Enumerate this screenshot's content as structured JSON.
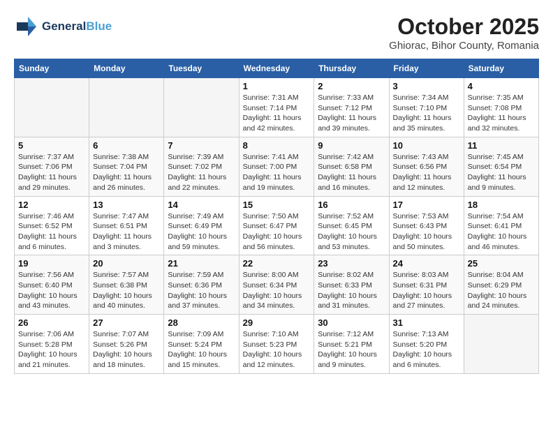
{
  "header": {
    "logo_line1": "General",
    "logo_line2": "Blue",
    "month": "October 2025",
    "location": "Ghiorac, Bihor County, Romania"
  },
  "weekdays": [
    "Sunday",
    "Monday",
    "Tuesday",
    "Wednesday",
    "Thursday",
    "Friday",
    "Saturday"
  ],
  "weeks": [
    [
      {
        "day": "",
        "info": ""
      },
      {
        "day": "",
        "info": ""
      },
      {
        "day": "",
        "info": ""
      },
      {
        "day": "1",
        "info": "Sunrise: 7:31 AM\nSunset: 7:14 PM\nDaylight: 11 hours\nand 42 minutes."
      },
      {
        "day": "2",
        "info": "Sunrise: 7:33 AM\nSunset: 7:12 PM\nDaylight: 11 hours\nand 39 minutes."
      },
      {
        "day": "3",
        "info": "Sunrise: 7:34 AM\nSunset: 7:10 PM\nDaylight: 11 hours\nand 35 minutes."
      },
      {
        "day": "4",
        "info": "Sunrise: 7:35 AM\nSunset: 7:08 PM\nDaylight: 11 hours\nand 32 minutes."
      }
    ],
    [
      {
        "day": "5",
        "info": "Sunrise: 7:37 AM\nSunset: 7:06 PM\nDaylight: 11 hours\nand 29 minutes."
      },
      {
        "day": "6",
        "info": "Sunrise: 7:38 AM\nSunset: 7:04 PM\nDaylight: 11 hours\nand 26 minutes."
      },
      {
        "day": "7",
        "info": "Sunrise: 7:39 AM\nSunset: 7:02 PM\nDaylight: 11 hours\nand 22 minutes."
      },
      {
        "day": "8",
        "info": "Sunrise: 7:41 AM\nSunset: 7:00 PM\nDaylight: 11 hours\nand 19 minutes."
      },
      {
        "day": "9",
        "info": "Sunrise: 7:42 AM\nSunset: 6:58 PM\nDaylight: 11 hours\nand 16 minutes."
      },
      {
        "day": "10",
        "info": "Sunrise: 7:43 AM\nSunset: 6:56 PM\nDaylight: 11 hours\nand 12 minutes."
      },
      {
        "day": "11",
        "info": "Sunrise: 7:45 AM\nSunset: 6:54 PM\nDaylight: 11 hours\nand 9 minutes."
      }
    ],
    [
      {
        "day": "12",
        "info": "Sunrise: 7:46 AM\nSunset: 6:52 PM\nDaylight: 11 hours\nand 6 minutes."
      },
      {
        "day": "13",
        "info": "Sunrise: 7:47 AM\nSunset: 6:51 PM\nDaylight: 11 hours\nand 3 minutes."
      },
      {
        "day": "14",
        "info": "Sunrise: 7:49 AM\nSunset: 6:49 PM\nDaylight: 10 hours\nand 59 minutes."
      },
      {
        "day": "15",
        "info": "Sunrise: 7:50 AM\nSunset: 6:47 PM\nDaylight: 10 hours\nand 56 minutes."
      },
      {
        "day": "16",
        "info": "Sunrise: 7:52 AM\nSunset: 6:45 PM\nDaylight: 10 hours\nand 53 minutes."
      },
      {
        "day": "17",
        "info": "Sunrise: 7:53 AM\nSunset: 6:43 PM\nDaylight: 10 hours\nand 50 minutes."
      },
      {
        "day": "18",
        "info": "Sunrise: 7:54 AM\nSunset: 6:41 PM\nDaylight: 10 hours\nand 46 minutes."
      }
    ],
    [
      {
        "day": "19",
        "info": "Sunrise: 7:56 AM\nSunset: 6:40 PM\nDaylight: 10 hours\nand 43 minutes."
      },
      {
        "day": "20",
        "info": "Sunrise: 7:57 AM\nSunset: 6:38 PM\nDaylight: 10 hours\nand 40 minutes."
      },
      {
        "day": "21",
        "info": "Sunrise: 7:59 AM\nSunset: 6:36 PM\nDaylight: 10 hours\nand 37 minutes."
      },
      {
        "day": "22",
        "info": "Sunrise: 8:00 AM\nSunset: 6:34 PM\nDaylight: 10 hours\nand 34 minutes."
      },
      {
        "day": "23",
        "info": "Sunrise: 8:02 AM\nSunset: 6:33 PM\nDaylight: 10 hours\nand 31 minutes."
      },
      {
        "day": "24",
        "info": "Sunrise: 8:03 AM\nSunset: 6:31 PM\nDaylight: 10 hours\nand 27 minutes."
      },
      {
        "day": "25",
        "info": "Sunrise: 8:04 AM\nSunset: 6:29 PM\nDaylight: 10 hours\nand 24 minutes."
      }
    ],
    [
      {
        "day": "26",
        "info": "Sunrise: 7:06 AM\nSunset: 5:28 PM\nDaylight: 10 hours\nand 21 minutes."
      },
      {
        "day": "27",
        "info": "Sunrise: 7:07 AM\nSunset: 5:26 PM\nDaylight: 10 hours\nand 18 minutes."
      },
      {
        "day": "28",
        "info": "Sunrise: 7:09 AM\nSunset: 5:24 PM\nDaylight: 10 hours\nand 15 minutes."
      },
      {
        "day": "29",
        "info": "Sunrise: 7:10 AM\nSunset: 5:23 PM\nDaylight: 10 hours\nand 12 minutes."
      },
      {
        "day": "30",
        "info": "Sunrise: 7:12 AM\nSunset: 5:21 PM\nDaylight: 10 hours\nand 9 minutes."
      },
      {
        "day": "31",
        "info": "Sunrise: 7:13 AM\nSunset: 5:20 PM\nDaylight: 10 hours\nand 6 minutes."
      },
      {
        "day": "",
        "info": ""
      }
    ]
  ]
}
